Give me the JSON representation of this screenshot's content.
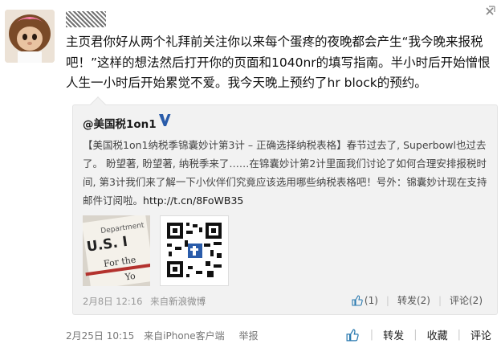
{
  "post": {
    "text": "主页君你好从两个礼拜前关注你以来每个蛋疼的夜晚都会产生“我今晚来报税吧！”这样的想法然后打开你的页面和1040nr的填写指南。半小时后开始憎恨人生一小时后开始累觉不爱。我今天晚上预约了hr block的预约。",
    "time": "2月25日 10:15",
    "source_prefix": "来自",
    "source": "iPhone客户端",
    "report": "举报",
    "repost_label": "转发",
    "favorite_label": "收藏",
    "comment_label": "评论"
  },
  "repost": {
    "author": "@美国税1on1",
    "text": "【美国税1on1纳税季锦囊妙计第3计 – 正确选择纳税表格】春节过去了, Superbowl也过去了。 盼望著, 盼望著, 纳税季来了……在锦囊妙计第2计里面我们讨论了如何合理安排报税时间, 第3计我们来了解一下小伙伴们究竟应该选用哪些纳税表格吧！号外：锦囊妙计现在支持邮件订阅啦。",
    "link": "http://t.cn/8FoWB35",
    "time": "2月8日 12:16",
    "source_prefix": "来自",
    "source": "新浪微博",
    "like_count": "(1)",
    "repost_label": "转发(2)",
    "comment_label": "评论(2)"
  },
  "thumbnail": {
    "form_title": "Department",
    "form_name": "U.S. I",
    "line1": "For the",
    "line2": "Yo"
  },
  "colors": {
    "verified": "#2a5caa",
    "link_like": "#2a7ab0"
  }
}
